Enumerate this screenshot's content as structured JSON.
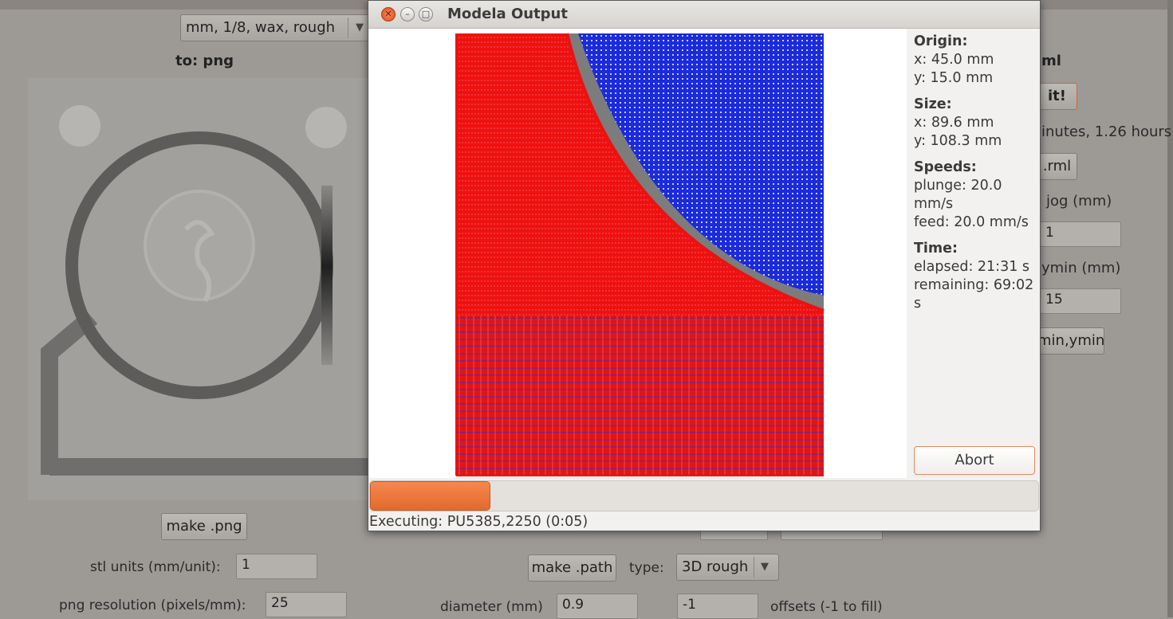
{
  "background": {
    "machine_combo": "mm, 1/8, wax, rough",
    "to_label": "to: png",
    "right_heading_partial": "ml",
    "make_it_partial": "it!",
    "time_partial": "inutes, 1.26 hours",
    "rml_button_partial": ".rml",
    "jog_label_partial": "jog (mm)",
    "jog_value_partial": "1",
    "ymin_label_partial": "ymin (mm)",
    "ymin_value_partial": "15",
    "xmin_ymin_button_partial": "min,ymin",
    "make_png_button": "make .png",
    "stl_units_label": "stl units (mm/unit):",
    "stl_units_value": "1",
    "png_res_label": "png resolution (pixels/mm):",
    "png_res_value": "25",
    "make_path_button": "make .path",
    "type_label": "type:",
    "type_value": "3D rough",
    "diameter_label": "diameter (mm)",
    "diameter_value": "0.9",
    "offsets_value": "-1",
    "offsets_label": "offsets (-1 to fill)"
  },
  "dialog": {
    "title": "Modela Output",
    "origin_heading": "Origin:",
    "origin_x": "x: 45.0 mm",
    "origin_y": "y: 15.0 mm",
    "size_heading": "Size:",
    "size_x": "x: 89.6 mm",
    "size_y": "y: 108.3 mm",
    "speeds_heading": "Speeds:",
    "plunge": "plunge: 20.0 mm/s",
    "feed": "feed: 20.0 mm/s",
    "time_heading": "Time:",
    "elapsed": "elapsed: 21:31 s",
    "remaining": "remaining: 69:02 s",
    "abort_button": "Abort",
    "progress_percent": 18,
    "status": "Executing: PU5385,2250 (0:05)"
  },
  "colors": {
    "toolpath_red": "#ee1111",
    "toolpath_blue": "#1122dd",
    "cut_gray": "#7c7c7c",
    "progress_orange": "#e8733a",
    "close_button": "#e25a2a"
  },
  "icons": {
    "close": "close-icon",
    "minimize": "minimize-icon",
    "maximize": "maximize-icon",
    "dropdown": "chevron-down-icon"
  }
}
